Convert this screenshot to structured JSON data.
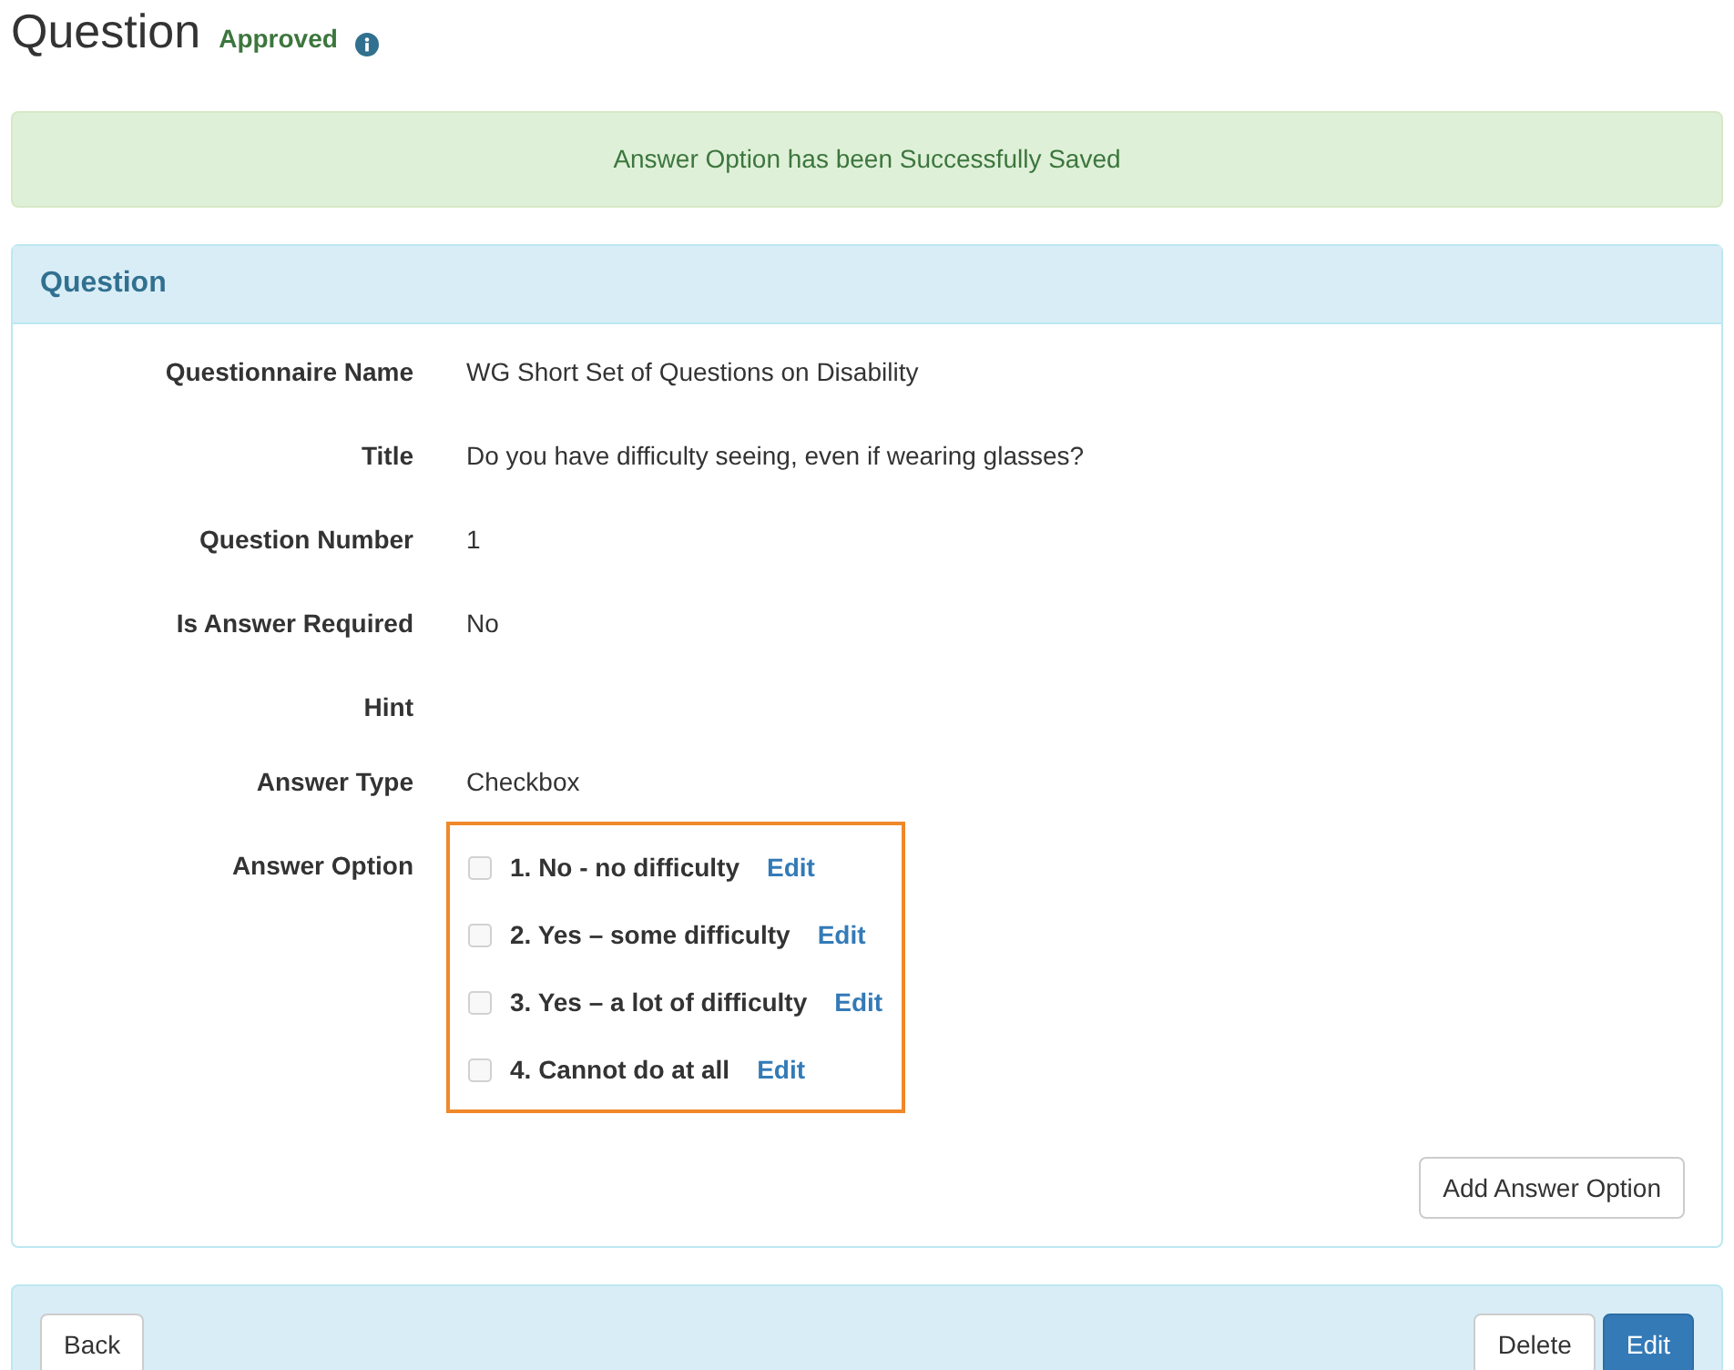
{
  "page_title": "Question",
  "status": {
    "label": "Approved"
  },
  "alert": {
    "message": "Answer Option has been Successfully Saved"
  },
  "panel": {
    "title": "Question",
    "fields": [
      {
        "label": "Questionnaire Name",
        "value": "WG Short Set of Questions on Disability"
      },
      {
        "label": "Title",
        "value": "Do you have difficulty seeing, even if wearing glasses?"
      },
      {
        "label": "Question Number",
        "value": "1"
      },
      {
        "label": "Is Answer Required",
        "value": "No"
      },
      {
        "label": "Hint"
      },
      {
        "label": "Answer Type",
        "value": "Checkbox"
      }
    ],
    "answer_options": {
      "label": "Answer Option",
      "items": [
        {
          "text": "1. No - no difficulty",
          "checked": false,
          "link": "Edit"
        },
        {
          "text": "2. Yes – some difficulty",
          "checked": false,
          "link": "Edit"
        },
        {
          "text": "3. Yes – a lot of difficulty",
          "checked": false,
          "link": "Edit"
        },
        {
          "text": "4. Cannot do at all",
          "checked": false,
          "link": "Edit"
        }
      ]
    },
    "add_button": "Add Answer Option"
  },
  "footer": {
    "back_button": "Back",
    "delete_button": "Delete",
    "edit_button": "Edit"
  }
}
